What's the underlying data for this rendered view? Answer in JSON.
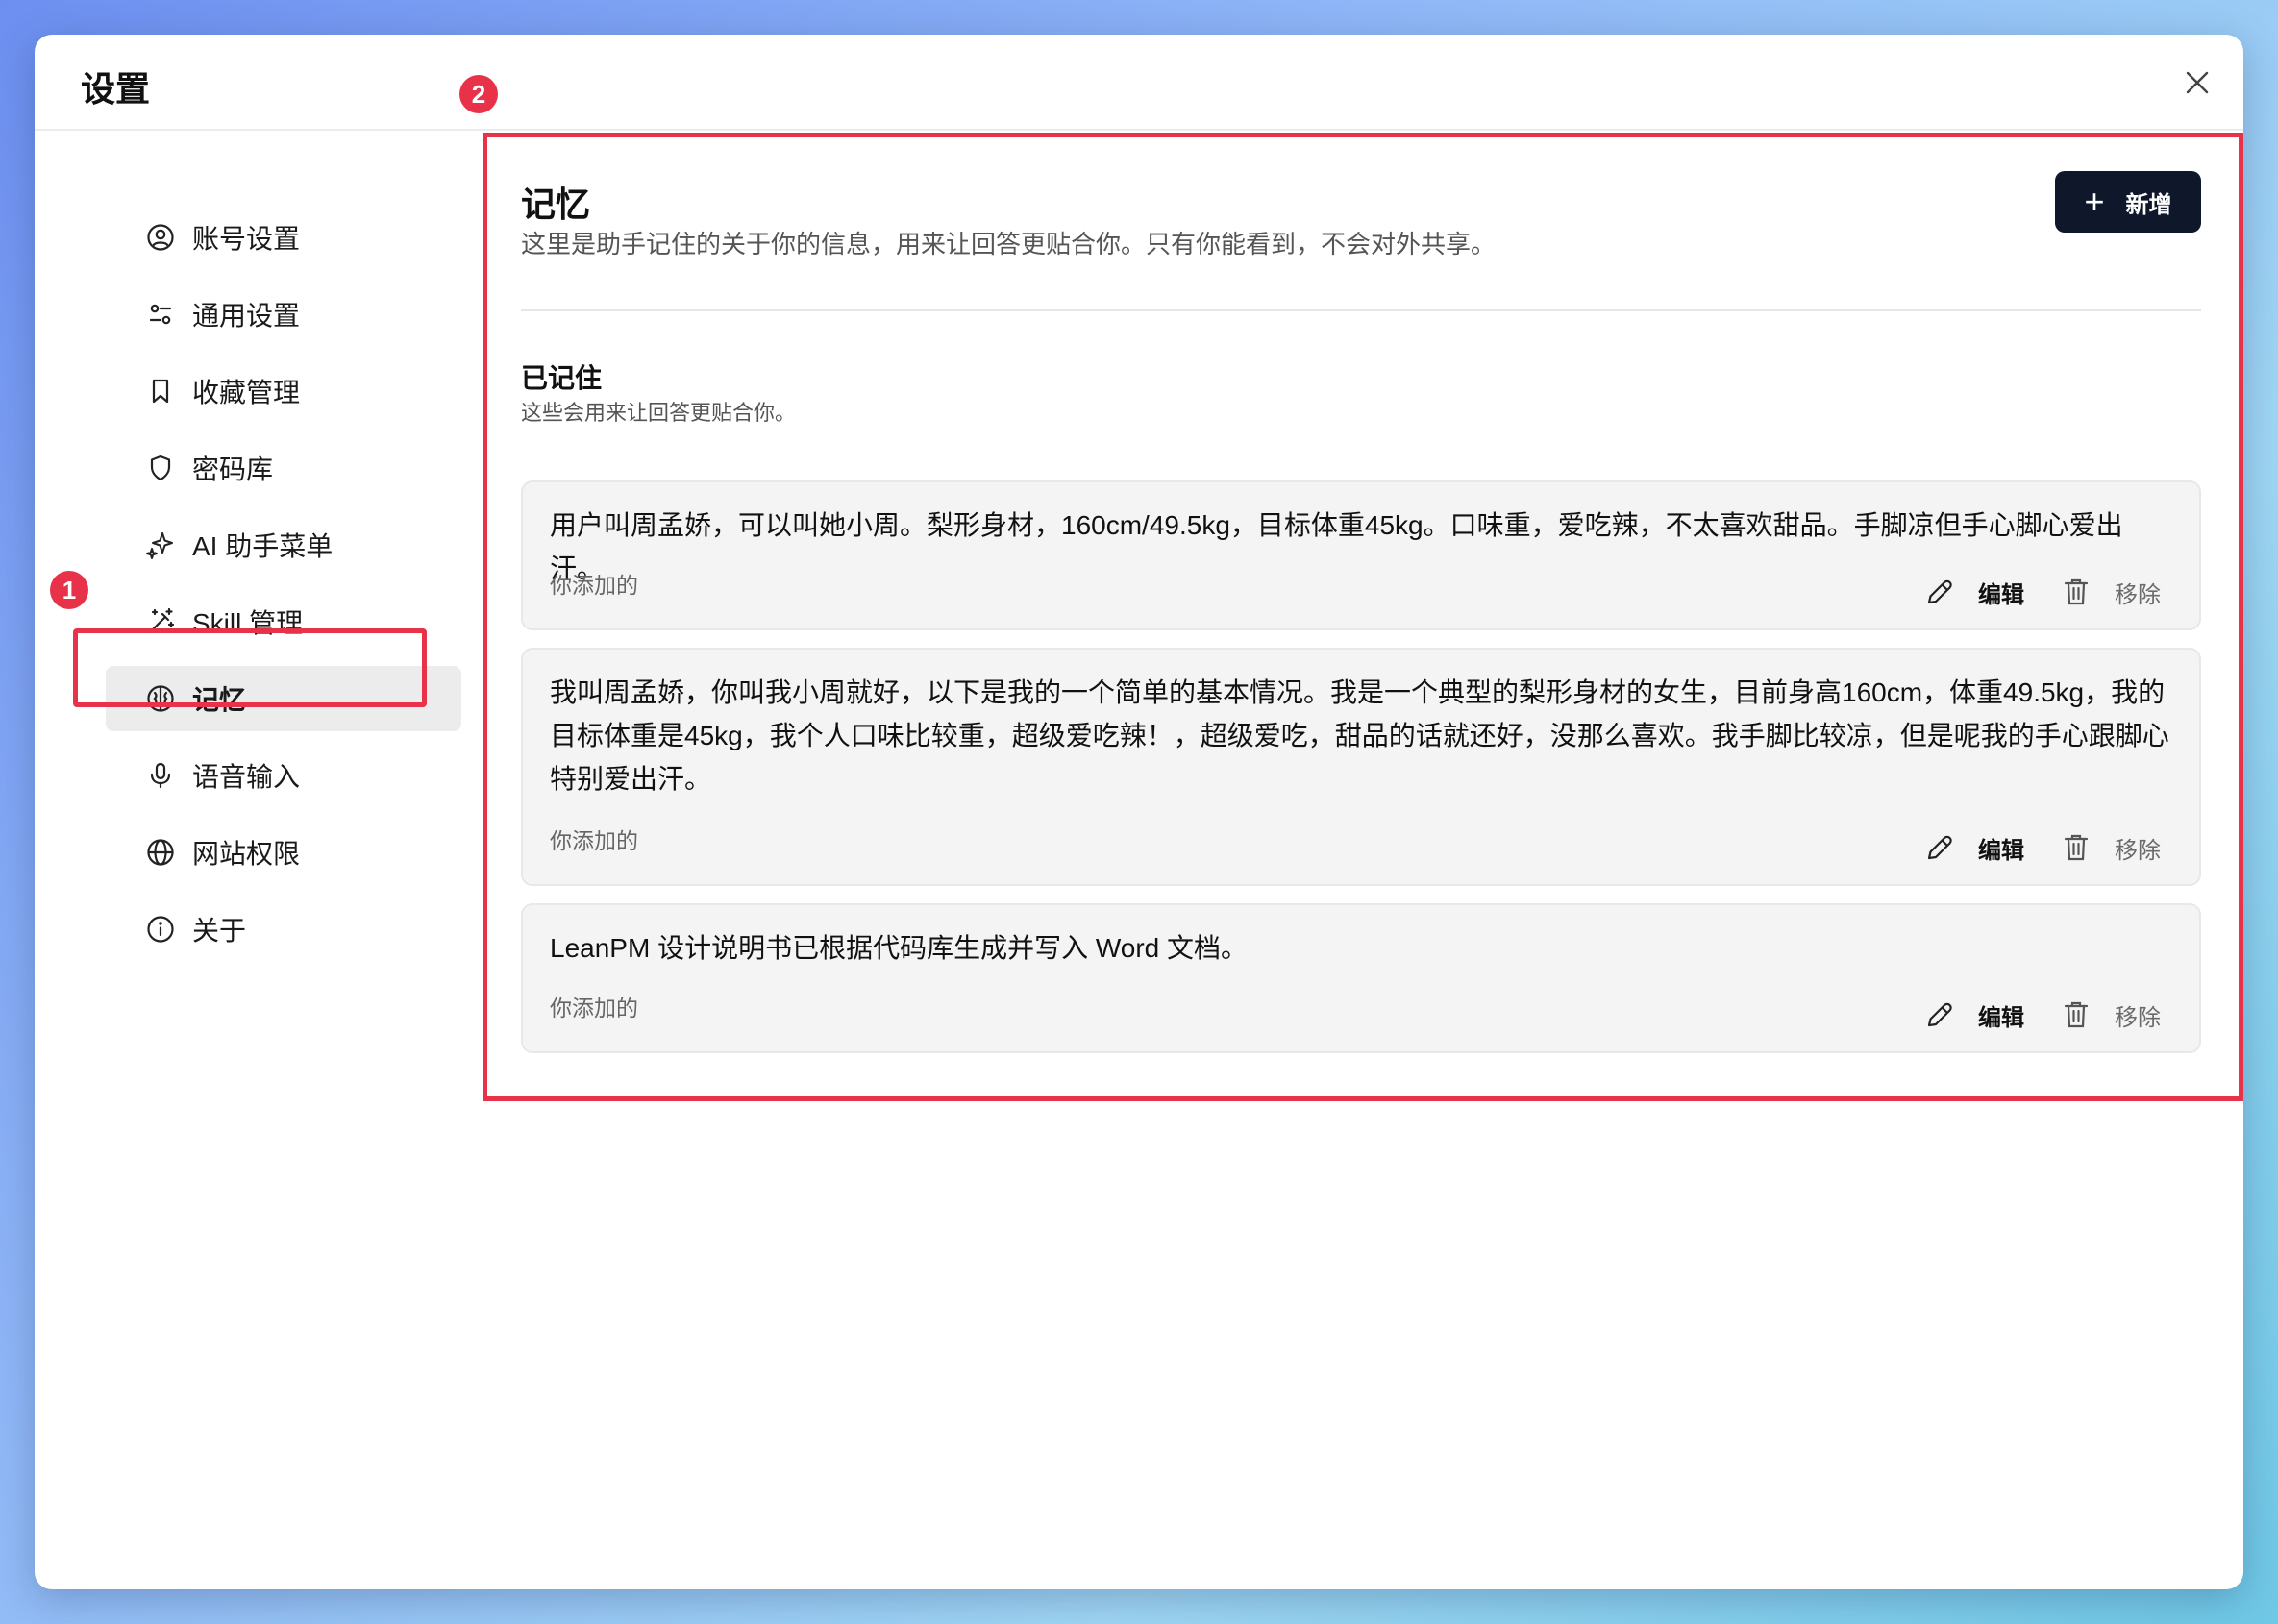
{
  "window": {
    "title": "设置",
    "close_icon": "close-icon"
  },
  "sidebar": {
    "items": [
      {
        "label": "账号设置",
        "icon": "user-circle-icon"
      },
      {
        "label": "通用设置",
        "icon": "sliders-icon"
      },
      {
        "label": "收藏管理",
        "icon": "bookmark-icon"
      },
      {
        "label": "密码库",
        "icon": "shield-icon"
      },
      {
        "label": "AI 助手菜单",
        "icon": "sparkles-icon"
      },
      {
        "label": "Skill 管理",
        "icon": "magic-wand-icon"
      },
      {
        "label": "记忆",
        "icon": "brain-icon",
        "active": true
      },
      {
        "label": "语音输入",
        "icon": "microphone-icon"
      },
      {
        "label": "网站权限",
        "icon": "globe-icon"
      },
      {
        "label": "关于",
        "icon": "info-icon"
      }
    ]
  },
  "annotations": {
    "badge_1": "1",
    "badge_2": "2",
    "highlight_color": "#e8324a"
  },
  "main": {
    "title": "记忆",
    "description": "这里是助手记住的关于你的信息，用来让回答更贴合你。只有你能看到，不会对外共享。",
    "add_button": {
      "icon": "+",
      "label": "新增"
    },
    "section": {
      "title": "已记住",
      "description": "这些会用来让回答更贴合你。"
    },
    "memories": [
      {
        "text": "用户叫周孟娇，可以叫她小周。梨形身材，160cm/49.5kg，目标体重45kg。口味重，爱吃辣，不太喜欢甜品。手脚凉但手心脚心爱出汗。",
        "source": "你添加的",
        "edit_label": "编辑",
        "remove_label": "移除"
      },
      {
        "text": "我叫周孟娇，你叫我小周就好，以下是我的一个简单的基本情况。我是一个典型的梨形身材的女生，目前身高160cm，体重49.5kg，我的目标体重是45kg，我个人口味比较重，超级爱吃辣！，超级爱吃，甜品的话就还好，没那么喜欢。我手脚比较凉，但是呢我的手心跟脚心特别爱出汗。",
        "source": "你添加的",
        "edit_label": "编辑",
        "remove_label": "移除"
      },
      {
        "text": "LeanPM 设计说明书已根据代码库生成并写入 Word 文档。",
        "source": "你添加的",
        "edit_label": "编辑",
        "remove_label": "移除"
      }
    ]
  }
}
